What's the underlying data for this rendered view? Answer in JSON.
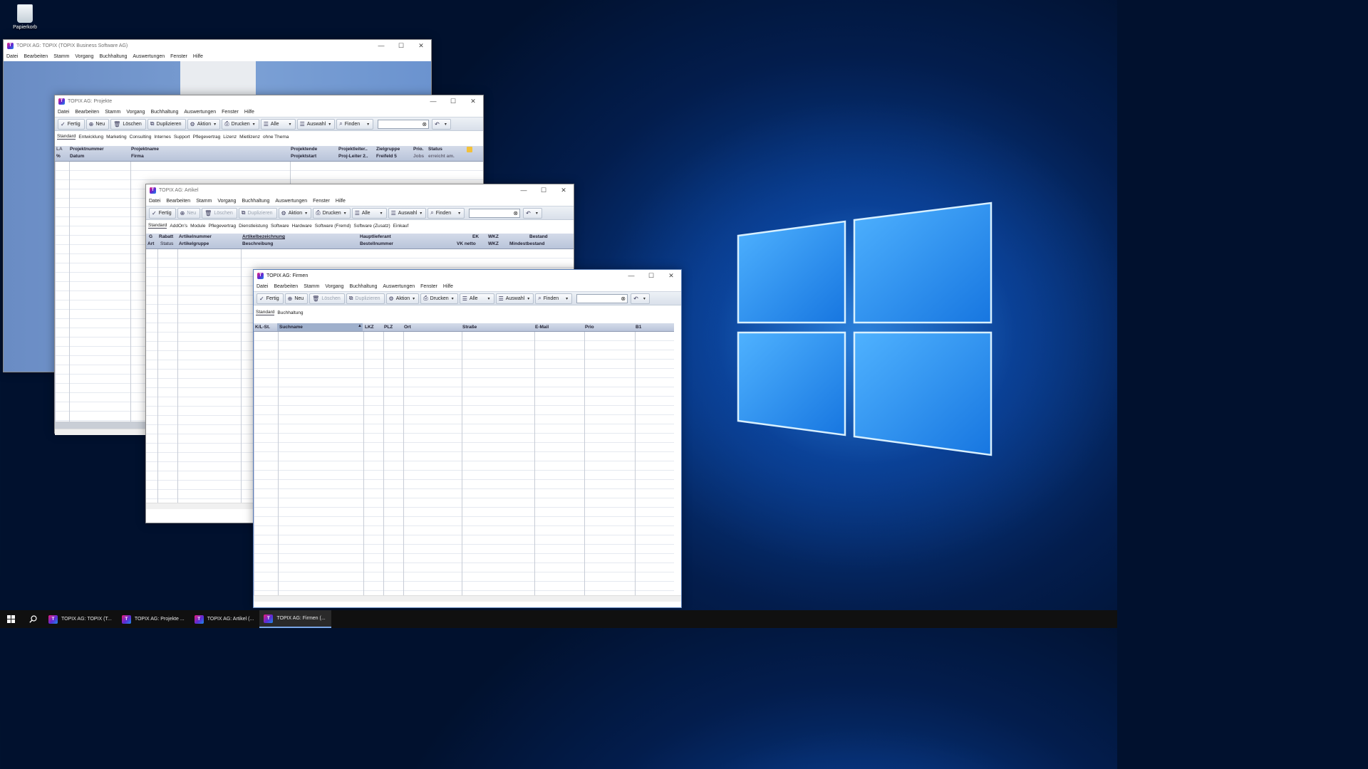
{
  "desktop": {
    "recycle_bin": "Papierkorb"
  },
  "main_window": {
    "title": "TOPIX AG: TOPIX (TOPIX Business Software AG)",
    "menu": [
      "Datei",
      "Bearbeiten",
      "Stamm",
      "Vorgang",
      "Buchhaltung",
      "Auswertungen",
      "Fenster",
      "Hilfe"
    ]
  },
  "projekte": {
    "title": "TOPIX AG: Projekte",
    "menu": [
      "Datei",
      "Bearbeiten",
      "Stamm",
      "Vorgang",
      "Buchhaltung",
      "Auswertungen",
      "Fenster",
      "Hilfe"
    ],
    "toolbar": {
      "fertig": "Fertig",
      "neu": "Neu",
      "loeschen": "Löschen",
      "duplizieren": "Duplizieren",
      "aktion": "Aktion",
      "drucken": "Drucken",
      "alle": "Alle",
      "auswahl": "Auswahl",
      "finden": "Finden"
    },
    "tabs": [
      "Standard",
      "Entwicklung",
      "Marketing",
      "Consulting",
      "Internes",
      "Support",
      "Pflegevertrag",
      "Lizenz",
      "Mietlizenz",
      "ohne Thema"
    ],
    "columns_top": [
      "LA",
      "Projektnummer",
      "Projektname",
      "Projektende",
      "Projektleiter..",
      "Zielgruppe",
      "Prio.",
      "Status"
    ],
    "columns_bottom": [
      "%",
      "Datum",
      "Firma",
      "Projektstart",
      "Proj-Leiter 2..",
      "Freifeld 5",
      "Jobs",
      "erreicht am."
    ]
  },
  "artikel": {
    "title": "TOPIX AG: Artikel",
    "menu": [
      "Datei",
      "Bearbeiten",
      "Stamm",
      "Vorgang",
      "Buchhaltung",
      "Auswertungen",
      "Fenster",
      "Hilfe"
    ],
    "toolbar": {
      "fertig": "Fertig",
      "neu": "Neu",
      "loeschen": "Löschen",
      "duplizieren": "Duplizieren",
      "aktion": "Aktion",
      "drucken": "Drucken",
      "alle": "Alle",
      "auswahl": "Auswahl",
      "finden": "Finden"
    },
    "tabs": [
      "Standard",
      "AddOn's",
      "Module",
      "Pflegevertrag",
      "Dienstleistung",
      "Software",
      "Hardware",
      "Software (Fremd)",
      "Software (Zusatz)",
      "Einkauf"
    ],
    "columns_top": [
      "G",
      "Rabatt",
      "Artikelnummer",
      "Artikelbezeichnung",
      "Hauptlieferant",
      "EK",
      "WKZ",
      "Bestand"
    ],
    "columns_bottom": [
      "Art",
      "Status",
      "Artikelgruppe",
      "Beschreibung",
      "Bestellnummer",
      "VK netto",
      "WKZ",
      "Mindestbestand"
    ]
  },
  "firmen": {
    "title": "TOPIX AG: Firmen",
    "menu": [
      "Datei",
      "Bearbeiten",
      "Stamm",
      "Vorgang",
      "Buchhaltung",
      "Auswertungen",
      "Fenster",
      "Hilfe"
    ],
    "toolbar": {
      "fertig": "Fertig",
      "neu": "Neu",
      "loeschen": "Löschen",
      "duplizieren": "Duplizieren",
      "aktion": "Aktion",
      "drucken": "Drucken",
      "alle": "Alle",
      "auswahl": "Auswahl",
      "finden": "Finden"
    },
    "tabs": [
      "Standard",
      "Buchhaltung"
    ],
    "columns": [
      "K/L-St.",
      "Suchname",
      "LKZ",
      "PLZ",
      "Ort",
      "Straße",
      "E-Mail",
      "Prio",
      "B1"
    ]
  },
  "taskbar": {
    "items": [
      "TOPIX AG: TOPIX (T...",
      "TOPIX AG: Projekte ...",
      "TOPIX AG: Artikel (...",
      "TOPIX AG: Firmen (..."
    ]
  }
}
